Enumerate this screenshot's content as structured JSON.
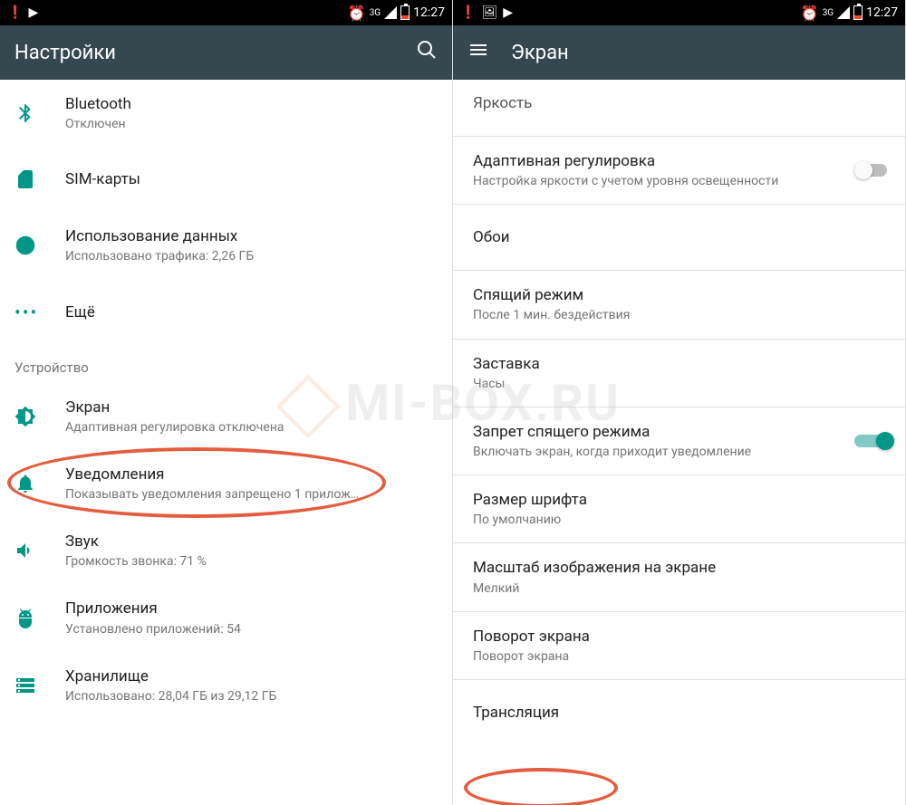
{
  "status": {
    "time": "12:27",
    "network": "3G",
    "left_icons": [
      "alert",
      "youtube"
    ],
    "left_icons2": [
      "alert",
      "image",
      "youtube"
    ]
  },
  "left_screen": {
    "title": "Настройки",
    "items": [
      {
        "title": "Bluetooth",
        "sub": "Отключен",
        "icon": "bluetooth"
      },
      {
        "title": "SIM-карты",
        "sub": "",
        "icon": "sim"
      },
      {
        "title": "Использование данных",
        "sub": "Использовано трафика: 2,26 ГБ",
        "icon": "data"
      },
      {
        "title": "Ещё",
        "sub": "",
        "icon": "more"
      }
    ],
    "section": "Устройство",
    "device_items": [
      {
        "title": "Экран",
        "sub": "Адаптивная регулировка отключена",
        "icon": "display"
      },
      {
        "title": "Уведомления",
        "sub": "Показывать уведомления запрещено 1 прилож…",
        "icon": "bell"
      },
      {
        "title": "Звук",
        "sub": "Громкость звонка: 71 %",
        "icon": "sound"
      },
      {
        "title": "Приложения",
        "sub": "Установлено приложений: 54",
        "icon": "apps"
      },
      {
        "title": "Хранилище",
        "sub": "Использовано: 28,04 ГБ из 29,12 ГБ",
        "icon": "storage"
      }
    ]
  },
  "right_screen": {
    "title": "Экран",
    "cutoff": "Яркость",
    "items": [
      {
        "title": "Адаптивная регулировка",
        "sub": "Настройка яркости с учетом уровня освещенности",
        "toggle": "off"
      },
      {
        "title": "Обои",
        "sub": ""
      },
      {
        "title": "Спящий режим",
        "sub": "После 1 мин. бездействия"
      },
      {
        "title": "Заставка",
        "sub": "Часы"
      },
      {
        "title": "Запрет спящего режима",
        "sub": "Включать экран, когда приходит уведомление",
        "toggle": "on"
      },
      {
        "title": "Размер шрифта",
        "sub": "По умолчанию"
      },
      {
        "title": "Масштаб изображения на экране",
        "sub": "Мелкий"
      },
      {
        "title": "Поворот экрана",
        "sub": "Поворот экрана"
      },
      {
        "title": "Трансляция",
        "sub": ""
      }
    ]
  },
  "watermark": "MI-BOX.RU"
}
